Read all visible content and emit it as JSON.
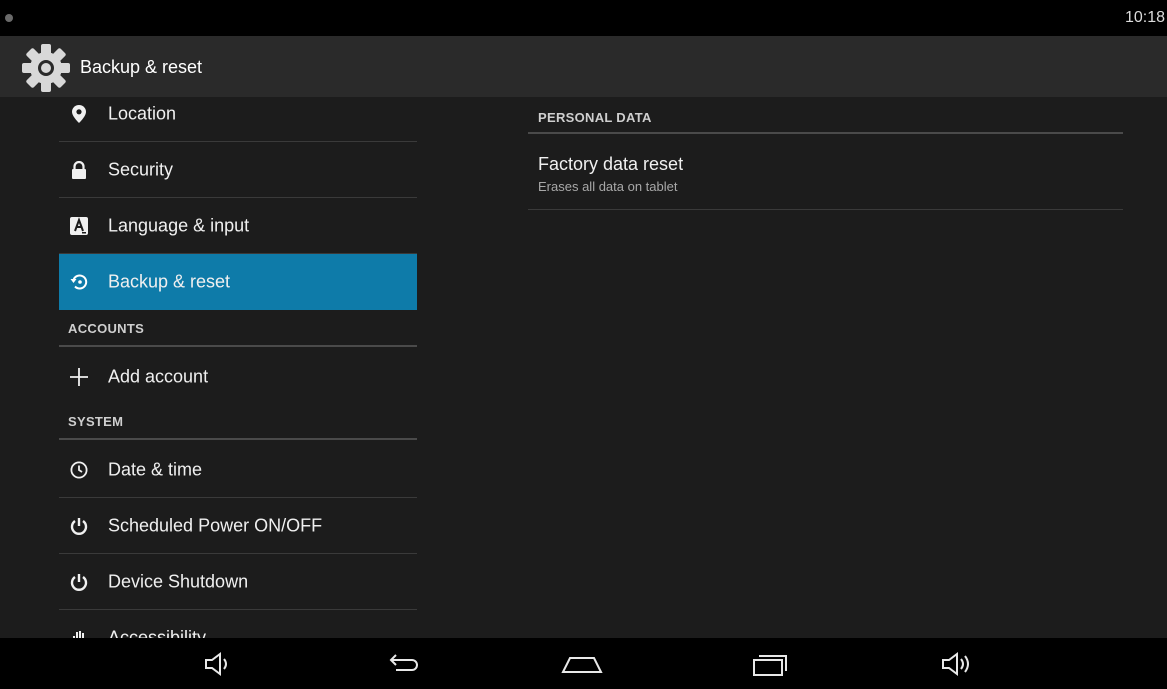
{
  "status_bar": {
    "time": "10:18"
  },
  "action_bar": {
    "title": "Backup & reset",
    "icon": "gear-icon"
  },
  "sidebar": {
    "items": [
      {
        "label": "Location",
        "icon": "location-pin-icon"
      },
      {
        "label": "Security",
        "icon": "lock-icon"
      },
      {
        "label": "Language & input",
        "icon": "keyboard-a-icon"
      },
      {
        "label": "Backup & reset",
        "icon": "backup-restore-icon",
        "selected": true
      }
    ],
    "accounts_header": "ACCOUNTS",
    "add_account": {
      "label": "Add account",
      "icon": "plus-icon"
    },
    "system_header": "SYSTEM",
    "system_items": [
      {
        "label": "Date & time",
        "icon": "clock-icon"
      },
      {
        "label": "Scheduled Power ON/OFF",
        "icon": "power-icon"
      },
      {
        "label": "Device Shutdown",
        "icon": "power-icon"
      },
      {
        "label": "Accessibility",
        "icon": "hand-icon"
      }
    ]
  },
  "detail": {
    "section_header": "PERSONAL DATA",
    "factory_reset": {
      "title": "Factory data reset",
      "summary": "Erases all data on tablet"
    }
  },
  "nav_bar": {
    "buttons": [
      "volume-down-icon",
      "back-icon",
      "home-icon",
      "recents-icon",
      "volume-up-icon"
    ]
  },
  "colors": {
    "accent_selected": "#0e7ba9",
    "background": "#1c1c1c",
    "action_bar": "#2a2a2a"
  }
}
